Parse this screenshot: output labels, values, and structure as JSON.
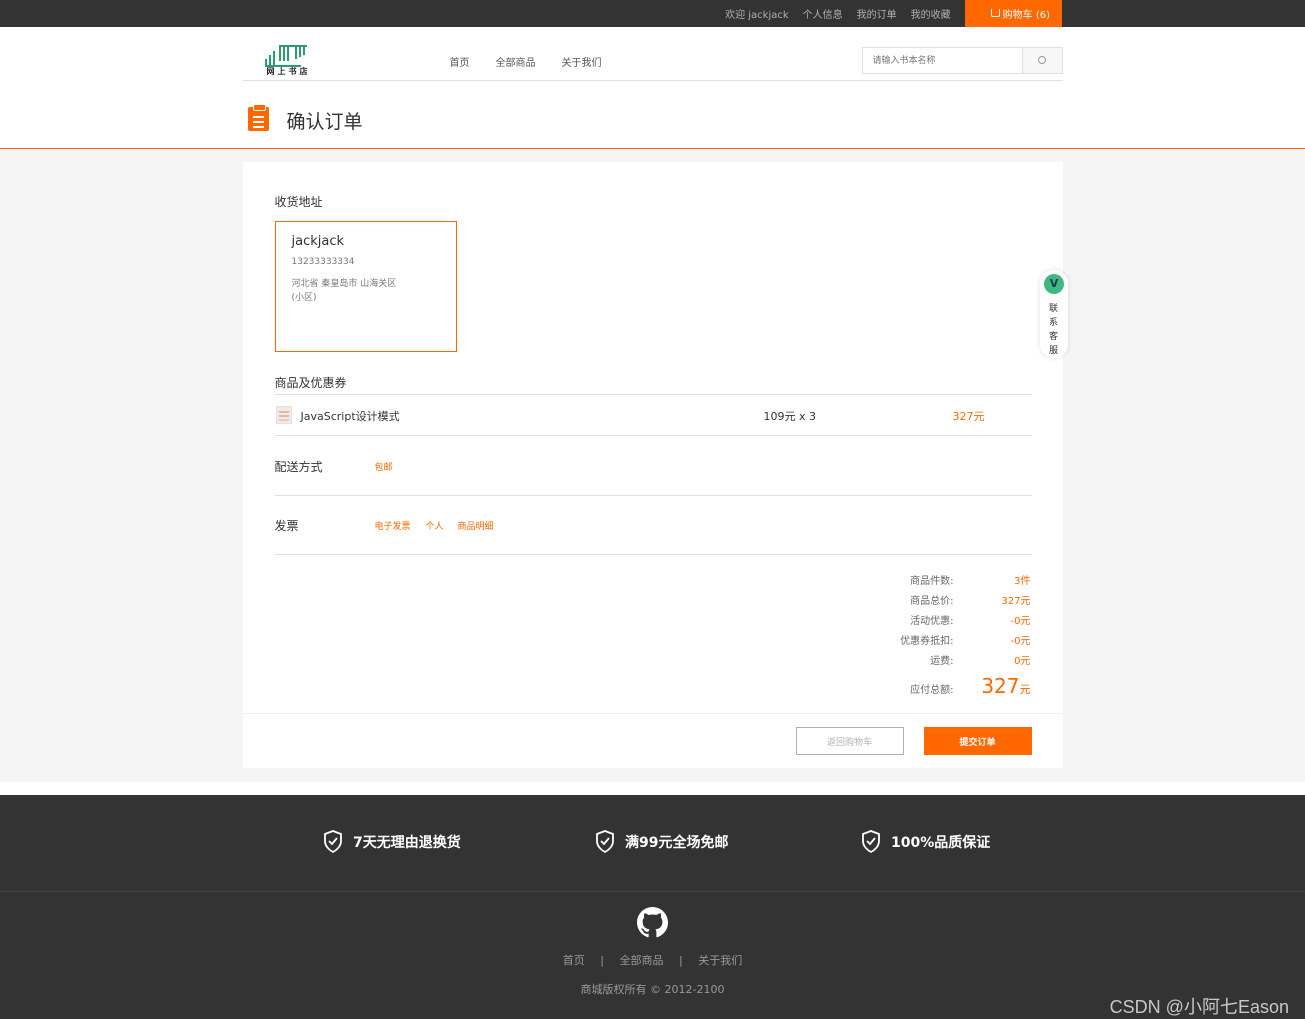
{
  "topbar": {
    "welcome": "欢迎 jackjack",
    "profile": "个人信息",
    "orders": "我的订单",
    "favorites": "我的收藏",
    "cart": "购物车 (6)"
  },
  "header": {
    "logo_text": "网上书店",
    "nav": [
      "首页",
      "全部商品",
      "关于我们"
    ],
    "search_placeholder": "请输入书本名称"
  },
  "page_title": "确认订单",
  "address": {
    "section_label": "收货地址",
    "name": "jackjack",
    "phone": "13233333334",
    "detail": "河北省 秦皇岛市 山海关区 (小区)"
  },
  "goods": {
    "section_label": "商品及优惠券",
    "items": [
      {
        "name": "JavaScript设计模式",
        "price": "109元 x 3",
        "total": "327元"
      }
    ]
  },
  "delivery": {
    "label": "配送方式",
    "value": "包邮"
  },
  "invoice": {
    "label": "发票",
    "options": [
      "电子发票",
      "个人",
      "商品明细"
    ]
  },
  "summary": {
    "rows": [
      {
        "key": "商品件数:",
        "value": "3件"
      },
      {
        "key": "商品总价:",
        "value": "327元"
      },
      {
        "key": "活动优惠:",
        "value": "-0元"
      },
      {
        "key": "优惠券抵扣:",
        "value": "-0元"
      },
      {
        "key": "运费:",
        "value": "0元"
      }
    ],
    "total_key": "应付总额:",
    "total_value": "327",
    "total_unit": "元"
  },
  "buttons": {
    "back": "返回购物车",
    "submit": "提交订单"
  },
  "service": {
    "badge": "V",
    "text": "联系客服"
  },
  "footer": {
    "promises": [
      "7天无理由退换货",
      "满99元全场免邮",
      "100%品质保证"
    ],
    "links": [
      "首页",
      "全部商品",
      "关于我们"
    ],
    "separator": "|",
    "copyright": "商城版权所有 © 2012-2100"
  },
  "watermark": "CSDN @小阿七Eason",
  "colors": {
    "accent": "#ff6700",
    "dark": "#333333",
    "vue_green": "#41b883"
  }
}
